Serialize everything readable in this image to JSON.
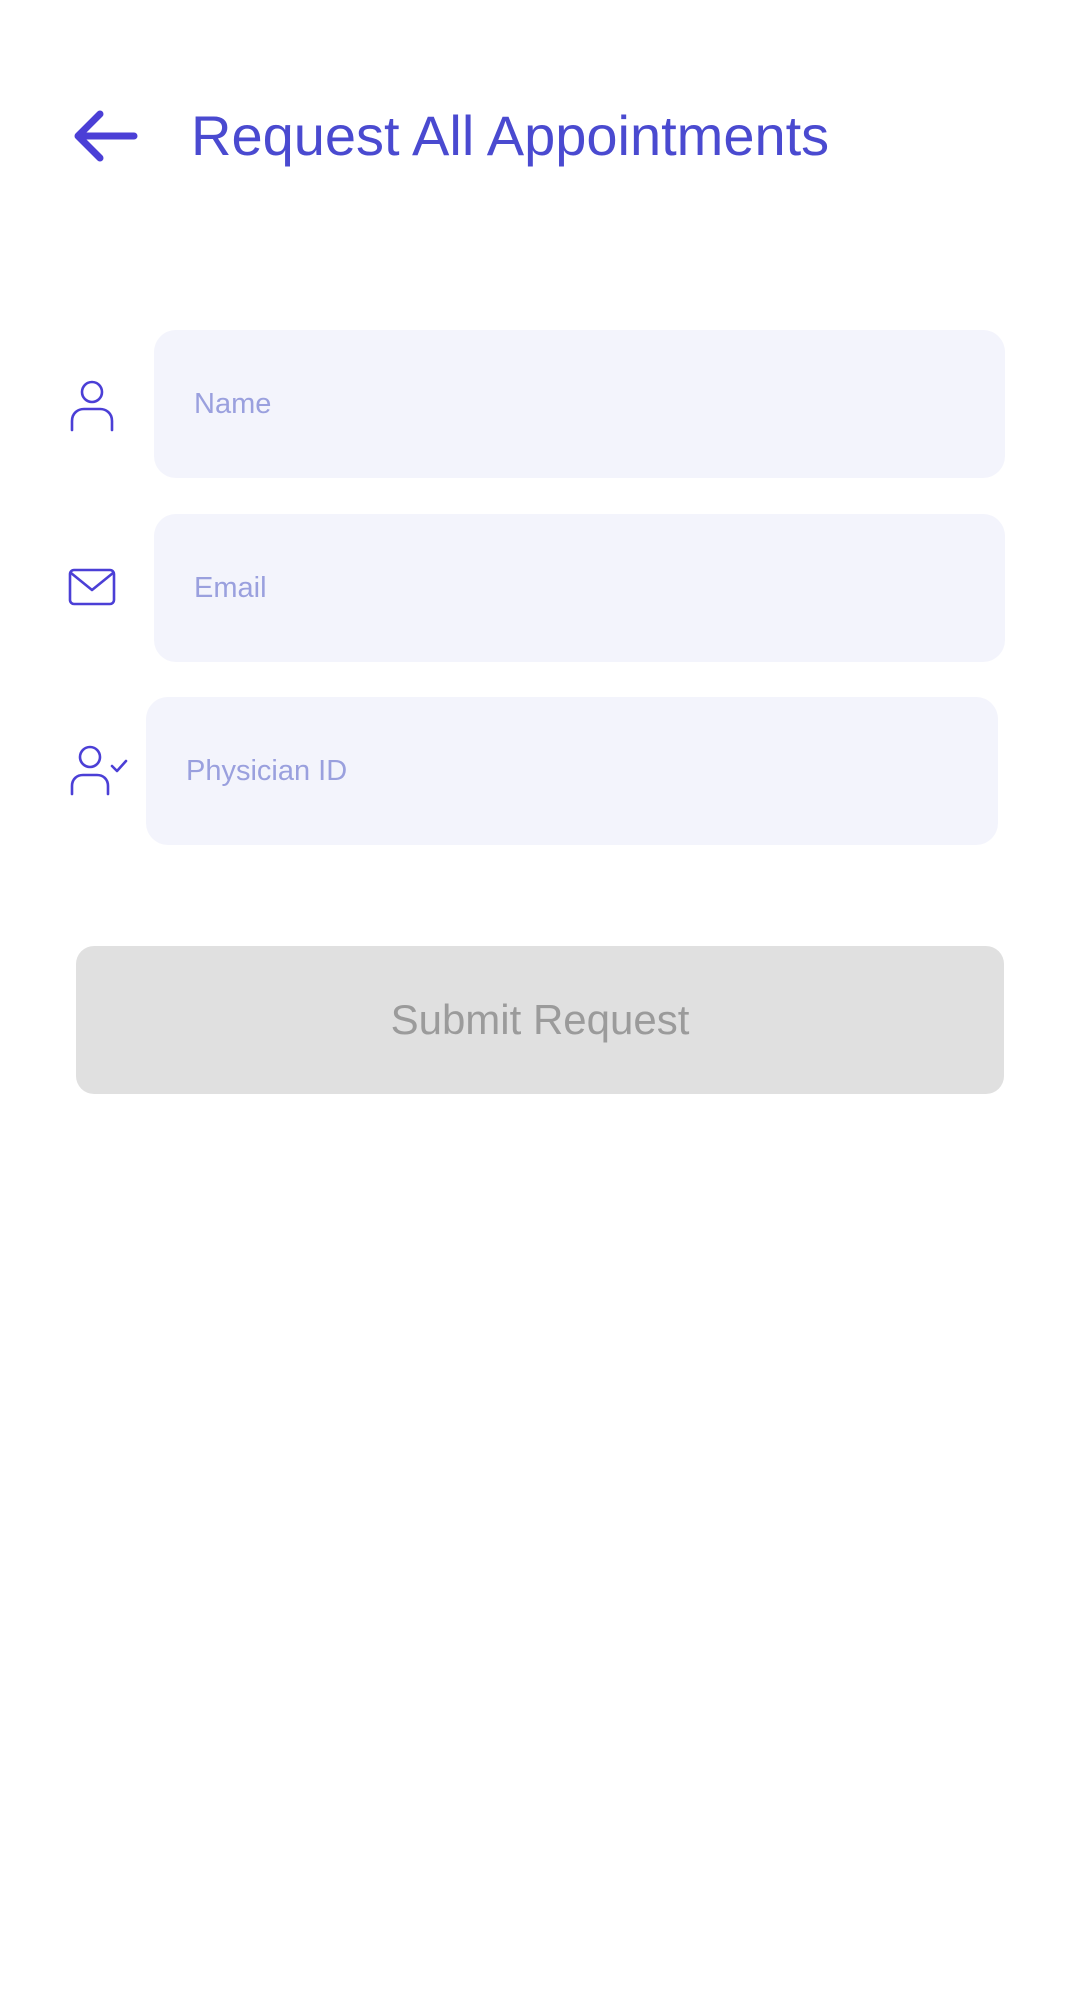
{
  "header": {
    "back_icon": "arrow-left-icon",
    "title": "Request All Appointments"
  },
  "form": {
    "name": {
      "icon": "user-icon",
      "placeholder": "Name",
      "value": ""
    },
    "email": {
      "icon": "mail-icon",
      "placeholder": "Email",
      "value": ""
    },
    "physician_id": {
      "icon": "user-check-icon",
      "placeholder": "Physician ID",
      "value": ""
    },
    "submit_label": "Submit Request",
    "submit_state": "disabled"
  },
  "colors": {
    "accent": "#4a4ad0",
    "icon_stroke": "#4b3fd6",
    "input_bg": "#f3f4fc",
    "placeholder": "#9aa0de",
    "button_bg_disabled": "#e0e0e0",
    "button_text_disabled": "#9b9b9b"
  }
}
